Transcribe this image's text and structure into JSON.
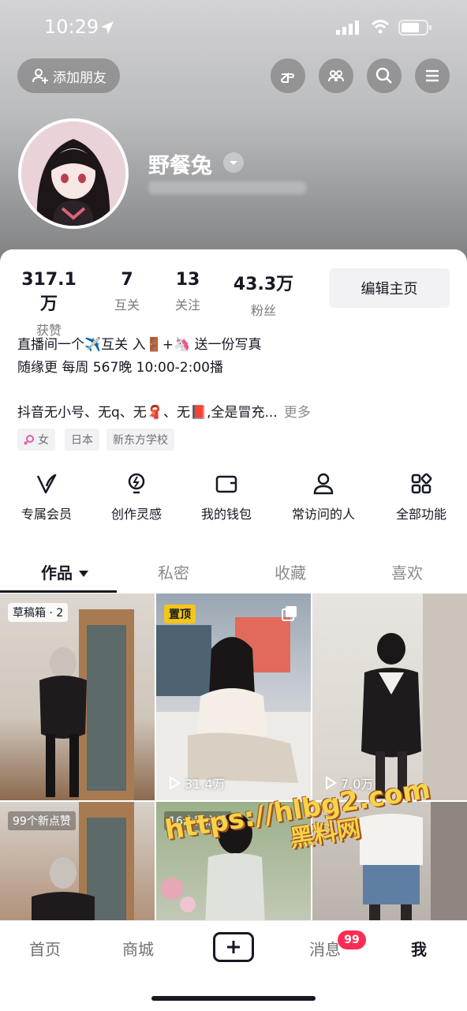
{
  "status_bar": {
    "time": "10:29"
  },
  "header": {
    "add_friend_label": "添加朋友",
    "username": "野餐兔"
  },
  "stats": [
    {
      "value": "317.1万",
      "label": "获赞"
    },
    {
      "value": "7",
      "label": "互关"
    },
    {
      "value": "13",
      "label": "关注"
    },
    {
      "value": "43.3万",
      "label": "粉丝"
    }
  ],
  "edit_profile_label": "编辑主页",
  "bio": {
    "line1": "直播间一个✈️互关 入🚪+🦄 送一份写真",
    "line2": "随缘更  每周 567晚 10:00-2:00播",
    "line3": "抖音无小号、无q、无🧣、无📕,全是冒充...",
    "more_label": "更多"
  },
  "tags": [
    {
      "icon": "female-icon",
      "label": "女"
    },
    {
      "label": "日本"
    },
    {
      "label": "新东方学校"
    }
  ],
  "features": [
    {
      "icon": "vip-v-icon",
      "label": "专属会员"
    },
    {
      "icon": "lightbulb-icon",
      "label": "创作灵感"
    },
    {
      "icon": "wallet-icon",
      "label": "我的钱包"
    },
    {
      "icon": "person-icon",
      "label": "常访问的人"
    },
    {
      "icon": "apps-grid-icon",
      "label": "全部功能"
    }
  ],
  "tabs": [
    {
      "label": "作品",
      "active": true
    },
    {
      "label": "私密"
    },
    {
      "label": "收藏"
    },
    {
      "label": "喜欢"
    }
  ],
  "videos": [
    {
      "badge": "草稿箱 · 2"
    },
    {
      "badge": "置顶",
      "plays": "31.4万"
    },
    {
      "plays": "7.0万"
    },
    {
      "badge": "99个新点赞"
    },
    {
      "badge": "16个新点赞"
    },
    {}
  ],
  "watermark": {
    "line1": "https://hlbg2.com",
    "line2": "黑料网"
  },
  "bottom_nav": {
    "home": "首页",
    "mall": "商城",
    "messages": "消息",
    "messages_badge": "99",
    "me": "我"
  },
  "colors": {
    "accent_red": "#fe2c55",
    "pin_yellow": "#f5c518",
    "text_primary": "#161823"
  }
}
